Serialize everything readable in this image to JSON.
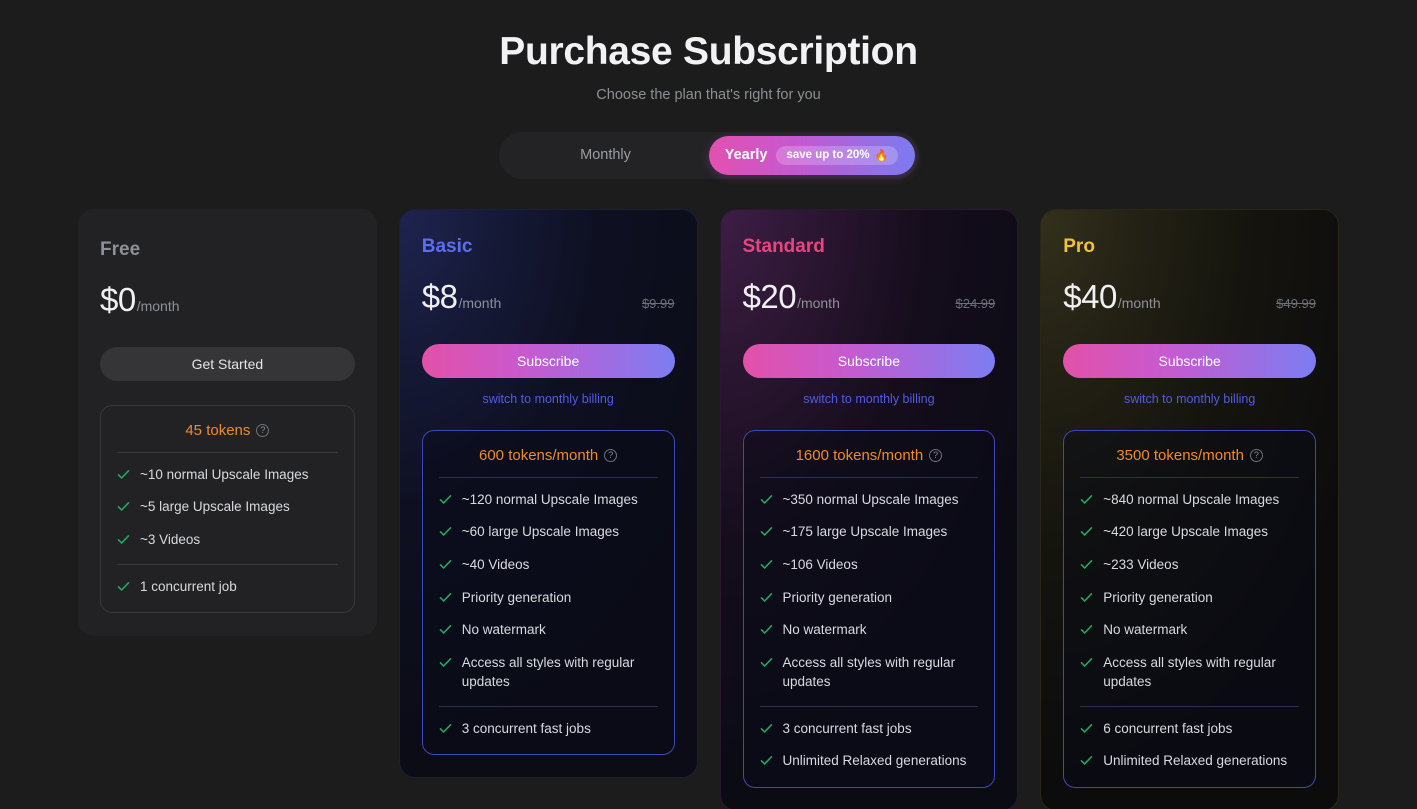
{
  "header": {
    "title": "Purchase Subscription",
    "subtitle": "Choose the plan that's right for you"
  },
  "billing_toggle": {
    "monthly_label": "Monthly",
    "yearly_label": "Yearly",
    "save_badge": "save up to 20%",
    "flame_icon": "🔥",
    "active": "Yearly"
  },
  "help_icon_glyph": "?",
  "plans": [
    {
      "name": "Free",
      "price": "$0",
      "period": "/month",
      "old_price": "",
      "cta_label": "Get Started",
      "switch_link": "",
      "tokens": "45 tokens",
      "features_primary": [
        "~10 normal Upscale Images",
        "~5 large Upscale Images",
        "~3 Videos"
      ],
      "features_secondary": [
        "1 concurrent job"
      ]
    },
    {
      "name": "Basic",
      "price": "$8",
      "period": "/month",
      "old_price": "$9.99",
      "cta_label": "Subscribe",
      "switch_link": "switch to monthly billing",
      "tokens": "600 tokens/month",
      "features_primary": [
        "~120 normal Upscale Images",
        "~60 large Upscale Images",
        "~40 Videos",
        "Priority generation",
        "No watermark",
        "Access all styles with regular updates"
      ],
      "features_secondary": [
        "3 concurrent fast jobs"
      ]
    },
    {
      "name": "Standard",
      "price": "$20",
      "period": "/month",
      "old_price": "$24.99",
      "cta_label": "Subscribe",
      "switch_link": "switch to monthly billing",
      "tokens": "1600 tokens/month",
      "features_primary": [
        "~350 normal Upscale Images",
        "~175 large Upscale Images",
        "~106 Videos",
        "Priority generation",
        "No watermark",
        "Access all styles with regular updates"
      ],
      "features_secondary": [
        "3 concurrent fast jobs",
        "Unlimited Relaxed generations"
      ]
    },
    {
      "name": "Pro",
      "price": "$40",
      "period": "/month",
      "old_price": "$49.99",
      "cta_label": "Subscribe",
      "switch_link": "switch to monthly billing",
      "tokens": "3500 tokens/month",
      "features_primary": [
        "~840 normal Upscale Images",
        "~420 large Upscale Images",
        "~233 Videos",
        "Priority generation",
        "No watermark",
        "Access all styles with regular updates"
      ],
      "features_secondary": [
        "6 concurrent fast jobs",
        "Unlimited Relaxed generations"
      ]
    }
  ],
  "colors": {
    "page_bg": "#1c1c1c",
    "accent_orange": "#f08a2a",
    "check_green": "#22a95a",
    "link_blue": "#4f5de0",
    "free_title": "#8e9098",
    "basic_title": "#5b6df0",
    "standard_title": "#e8457f",
    "pro_title": "#f2c23d",
    "gradient_start": "#e251a8",
    "gradient_end": "#7d7df2"
  }
}
